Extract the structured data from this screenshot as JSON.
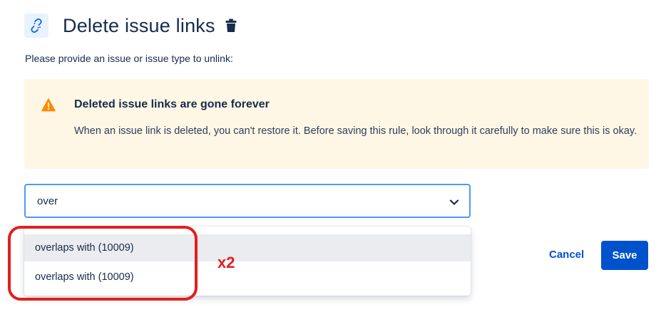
{
  "header": {
    "title": "Delete issue links",
    "icon": "unlink-icon",
    "action_icon": "trash-icon"
  },
  "subtitle": "Please provide an issue or issue type to unlink:",
  "warning": {
    "title": "Deleted issue links are gone forever",
    "body": "When an issue link is deleted, you can't restore it. Before saving this rule, look through it carefully to make sure this is okay.",
    "icon": "warning-icon",
    "colors": {
      "background": "#fff7e5",
      "icon": "#ff8b00"
    }
  },
  "select": {
    "value": "over",
    "icon": "chevron-down-icon"
  },
  "dropdown": {
    "options": [
      {
        "label": "overlaps with (10009)"
      },
      {
        "label": "overlaps with (10009)"
      }
    ]
  },
  "annotation": {
    "label": "x2",
    "color": "#e31e1e"
  },
  "actions": {
    "cancel_label": "Cancel",
    "save_label": "Save"
  },
  "colors": {
    "primary": "#0052cc",
    "focus_border": "#4c9aff",
    "text": "#172b4d"
  }
}
